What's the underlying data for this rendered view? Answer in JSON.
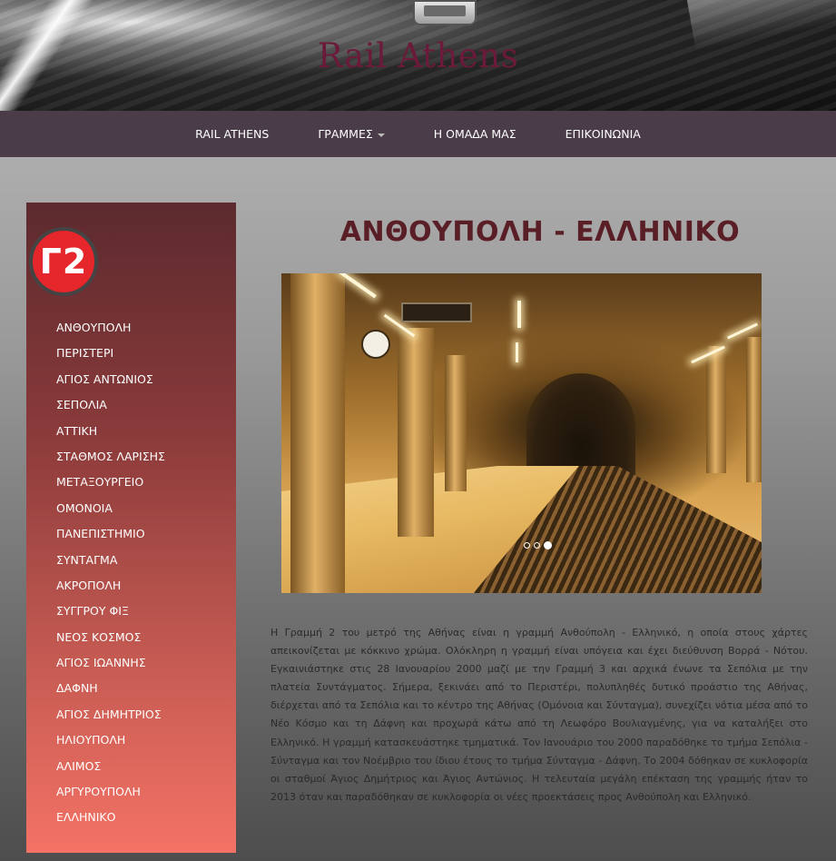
{
  "header": {
    "site_title": "Rail Athens",
    "logo_icon": "train-front-icon"
  },
  "nav": {
    "items": [
      {
        "label": "RAIL ATHENS",
        "dropdown": false
      },
      {
        "label": "ΓΡΑΜΜΕΣ",
        "dropdown": true
      },
      {
        "label": "Η ΟΜΑΔΑ ΜΑΣ",
        "dropdown": false
      },
      {
        "label": "ΕΠΙΚΟΙΝΩΝΙΑ",
        "dropdown": false
      }
    ]
  },
  "sidebar": {
    "line_badge": "Γ2",
    "badge_color": "#e5262a",
    "stations": [
      "ΑΝΘΟΥΠΟΛΗ",
      "ΠΕΡΙΣΤΕΡΙ",
      "ΑΓΙΟΣ ΑΝΤΩΝΙΟΣ",
      "ΣΕΠΟΛΙΑ",
      "ΑΤΤΙΚΗ",
      "ΣΤΑΘΜΟΣ ΛΑΡΙΣΗΣ",
      "ΜΕΤΑΞΟΥΡΓΕΙΟ",
      "ΟΜΟΝΟΙΑ",
      "ΠΑΝΕΠΙΣΤΗΜΙΟ",
      "ΣΥΝΤΑΓΜΑ",
      "ΑΚΡΟΠΟΛΗ",
      "ΣΥΓΓΡΟΥ ΦΙΞ",
      "ΝΕΟΣ ΚΟΣΜΟΣ",
      "ΑΓΙΟΣ ΙΩΑΝΝΗΣ",
      "ΔΑΦΝΗ",
      "ΑΓΙΟΣ ΔΗΜΗΤΡΙΟΣ",
      "ΗΛΙΟΥΠΟΛΗ",
      "ΑΛΙΜΟΣ",
      "ΑΡΓΥΡΟΥΠΟΛΗ",
      "ΕΛΛΗΝΙΚΟ"
    ]
  },
  "main": {
    "title": "ΑΝΘΟΥΠΟΛΗ - ΕΛΛΗΝΙΚΟ",
    "carousel": {
      "slide_count": 3,
      "active_slide": 3
    },
    "description": "Η Γραμμή 2 του μετρό της Αθήνας είναι η γραμμή Ανθούπολη - Ελληνικό, η οποία στους χάρτες απεικονίζεται με κόκκινο χρώμα. Ολόκληρη η γραμμή είναι υπόγεια και έχει διεύθυνση Βορρά - Νότου. Εγκαινιάστηκε στις 28 Ιανουαρίου 2000 μαζί με την Γραμμή 3 και αρχικά ένωνε τα Σεπόλια με την πλατεία Συντάγματος. Σήμερα, ξεκινάει από το Περιστέρι, πολυπληθές δυτικό προάστιο της Αθήνας, διέρχεται από τα Σεπόλια και το κέντρο της Αθήνας (Ομόνοια και Σύνταγμα), συνεχίζει νότια μέσα από το Νέο Κόσμο και τη Δάφνη και προχωρά κάτω από τη Λεωφόρο Βουλιαγμένης, για να καταλήξει στο Ελληνικό. Η γραμμή κατασκευάστηκε τμηματικά. Τον Ιανουάριο του 2000 παραδόθηκε το τμήμα Σεπόλια - Σύνταγμα και τον Νοέμβριο του ίδιου έτους το τμήμα Σύνταγμα - Δάφνη. Το 2004 δόθηκαν σε κυκλοφορία οι σταθμοί Άγιος Δημήτριος και Άγιος Αντώνιος. Η τελευταία μεγάλη επέκταση της γραμμής ήταν το 2013 όταν και παραδόθηκαν σε κυκλοφορία οι νέες προεκτάσεις προς Ανθούπολη και Ελληνικό."
  },
  "colors": {
    "nav_bg": "#4a3c48",
    "title_color": "#5a1e26",
    "site_title_color": "#6b1a3a"
  }
}
